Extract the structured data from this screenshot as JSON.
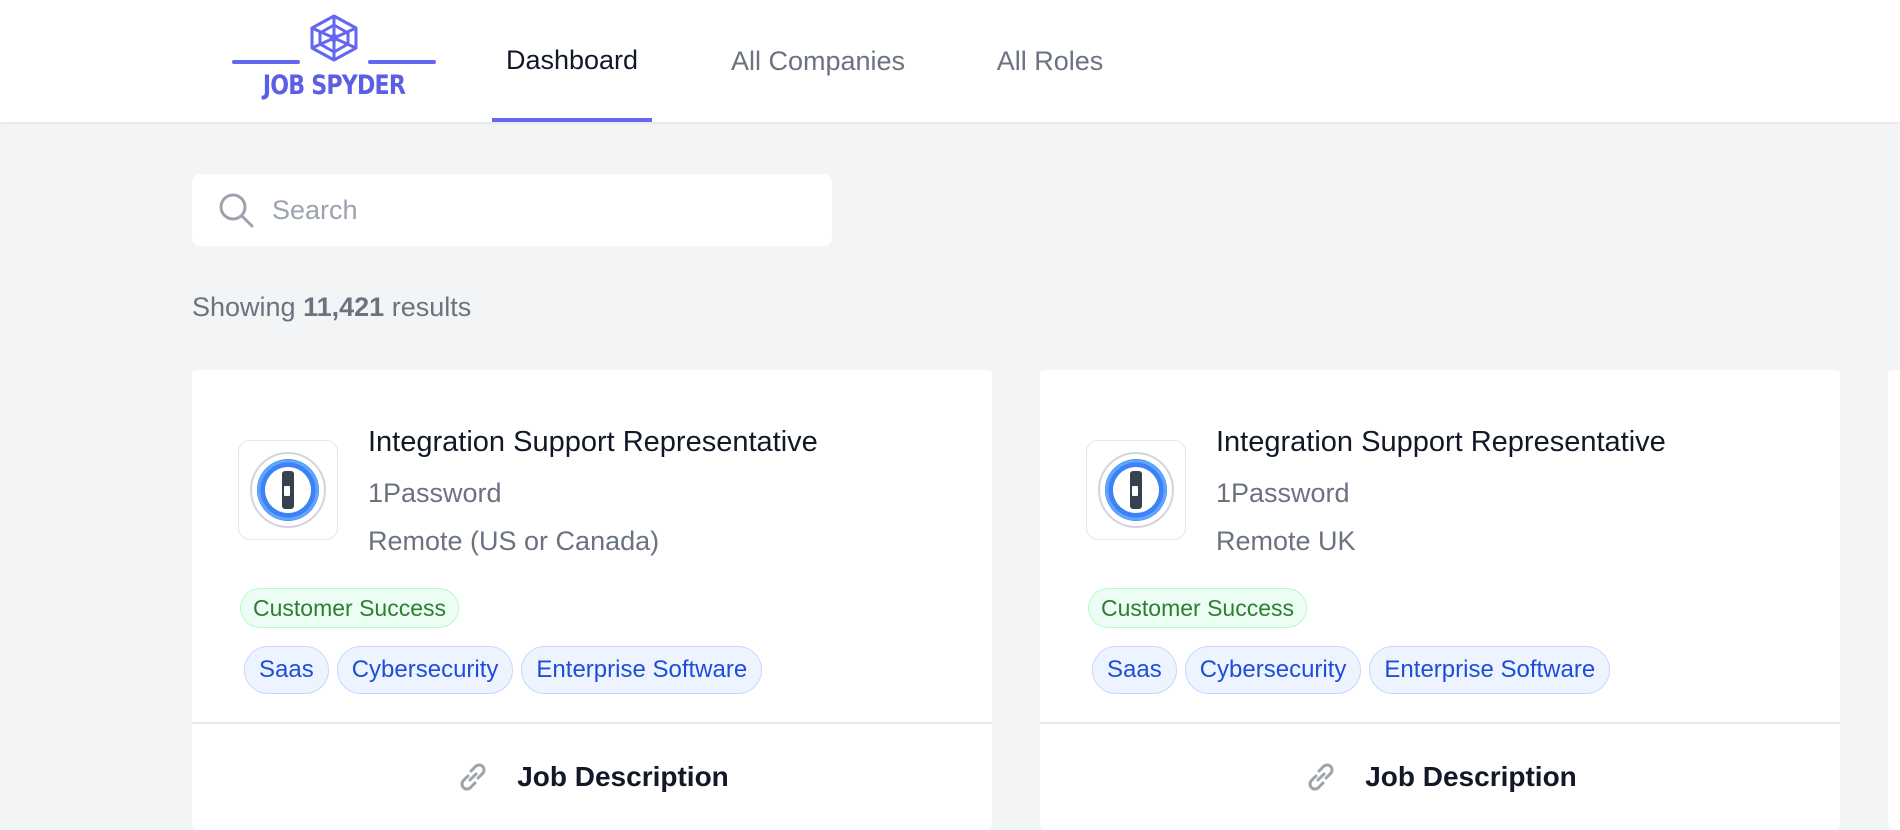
{
  "header": {
    "logo_text": "JOB SPYDER",
    "tabs": [
      {
        "label": "Dashboard",
        "active": true
      },
      {
        "label": "All Companies",
        "active": false
      },
      {
        "label": "All Roles",
        "active": false
      }
    ]
  },
  "search": {
    "placeholder": "Search",
    "value": ""
  },
  "results": {
    "prefix": "Showing",
    "count": "11,421",
    "suffix": "results"
  },
  "cards": [
    {
      "title": "Integration Support Representative",
      "company": "1Password",
      "location": "Remote (US or Canada)",
      "department": "Customer Success",
      "tags": [
        "Saas",
        "Cybersecurity",
        "Enterprise Software"
      ],
      "link_label": "Job Description"
    },
    {
      "title": "Integration Support Representative",
      "company": "1Password",
      "location": "Remote UK",
      "department": "Customer Success",
      "tags": [
        "Saas",
        "Cybersecurity",
        "Enterprise Software"
      ],
      "link_label": "Job Description"
    }
  ],
  "colors": {
    "accent": "#6366f1",
    "background": "#f3f4f6",
    "department_badge": "#2e7d32",
    "tag": "#1d4ed8"
  },
  "icons": {
    "logo": "spider-web-icon",
    "search": "search-icon",
    "company_logo": "1password-logo",
    "link": "link-icon"
  }
}
